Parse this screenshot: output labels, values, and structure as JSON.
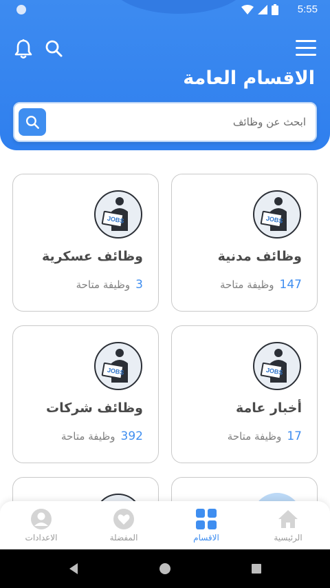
{
  "status_bar": {
    "time": "5:55"
  },
  "header": {
    "title": "الاقسام العامة",
    "icons": {
      "menu": "menu-icon",
      "bell": "bell-icon",
      "search": "search-icon"
    }
  },
  "search": {
    "placeholder": "ابحث عن وظائف",
    "value": ""
  },
  "cards": [
    {
      "title": "وظائف مدنية",
      "count": "147",
      "count_label": "وظيفة متاحة",
      "icon": "jobs-icon"
    },
    {
      "title": "وظائف عسكرية",
      "count": "3",
      "count_label": "وظيفة متاحة",
      "icon": "jobs-icon"
    },
    {
      "title": "أخبار عامة",
      "count": "17",
      "count_label": "وظيفة متاحة",
      "icon": "jobs-icon"
    },
    {
      "title": "وظائف شركات",
      "count": "392",
      "count_label": "وظيفة متاحة",
      "icon": "jobs-icon"
    }
  ],
  "bottom_nav": [
    {
      "label": "الرئيسية",
      "icon": "home-icon",
      "active": false
    },
    {
      "label": "الاقسام",
      "icon": "grid-icon",
      "active": true
    },
    {
      "label": "المفضلة",
      "icon": "heart-icon",
      "active": false
    },
    {
      "label": "الاعدادات",
      "icon": "user-icon",
      "active": false
    }
  ],
  "colors": {
    "primary": "#3f8ef0",
    "header": "#3d8bf0",
    "text": "#4a4a4a",
    "muted": "#808080"
  }
}
